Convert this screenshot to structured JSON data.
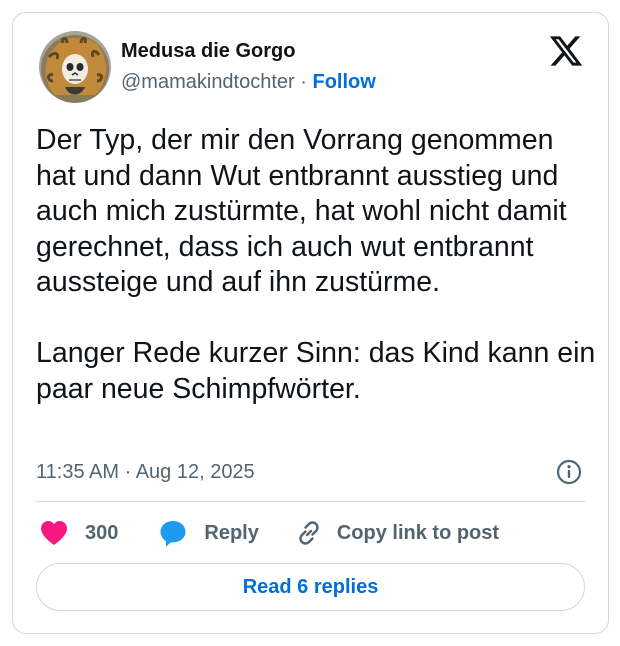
{
  "user": {
    "display_name": "Medusa die Gorgo",
    "handle": "@mamakindtochter",
    "separator": "·",
    "follow_label": "Follow",
    "avatar_icon": "medusa-avatar"
  },
  "brand": {
    "logo_icon": "x-logo-icon"
  },
  "tweet": {
    "text": "Der Typ, der mir den Vorrang genommen hat und dann Wut entbrannt ausstieg und auch mich zustürmte, hat wohl nicht damit gerechnet, dass ich auch wut entbrannt aussteige und auf ihn zustürme.\n\nLanger Rede kurzer Sinn: das Kind kann ein paar neue Schimpfwörter.",
    "timestamp": "11:35 AM · Aug 12, 2025"
  },
  "actions": {
    "like_count": "300",
    "reply_label": "Reply",
    "copy_link_label": "Copy link to post",
    "read_replies_label": "Read 6 replies"
  },
  "colors": {
    "heart": "#f91880",
    "reply_bubble": "#1d9bf0",
    "link_blue": "#006fd6",
    "text_gray": "#536471",
    "border": "#cfd9de"
  }
}
